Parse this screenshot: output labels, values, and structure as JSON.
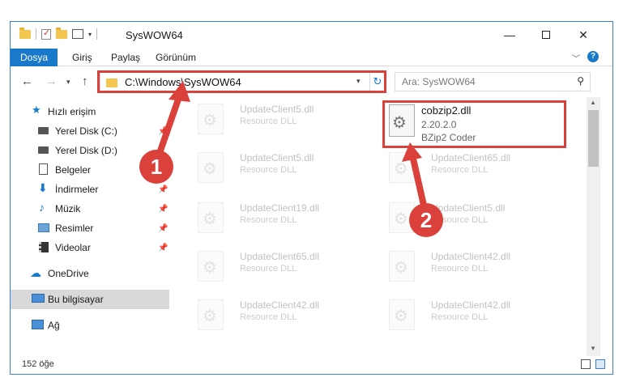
{
  "window": {
    "title": "SysWOW64",
    "controls": {
      "minimize": "—",
      "maximize": "",
      "close": "✕"
    }
  },
  "ribbon": {
    "tabs": [
      {
        "label": "Dosya",
        "active": true
      },
      {
        "label": "Giriş",
        "active": false
      },
      {
        "label": "Paylaş",
        "active": false
      },
      {
        "label": "Görünüm",
        "active": false
      }
    ],
    "help": "?"
  },
  "addressbar": {
    "path": "C:\\Windows\\SysWOW64",
    "search_placeholder": "Ara: SysWOW64"
  },
  "sidebar": {
    "items": [
      {
        "label": "Hızlı erişim",
        "icon": "star-icon",
        "pinned": false
      },
      {
        "label": "Yerel Disk (C:)",
        "icon": "drive-icon",
        "pinned": true
      },
      {
        "label": "Yerel Disk (D:)",
        "icon": "drive-icon",
        "pinned": false
      },
      {
        "label": "Belgeler",
        "icon": "document-icon",
        "pinned": true
      },
      {
        "label": "İndirmeler",
        "icon": "download-icon",
        "pinned": true
      },
      {
        "label": "Müzik",
        "icon": "music-icon",
        "pinned": true
      },
      {
        "label": "Resimler",
        "icon": "pictures-icon",
        "pinned": true
      },
      {
        "label": "Videolar",
        "icon": "video-icon",
        "pinned": true
      },
      {
        "label": "OneDrive",
        "icon": "cloud-icon",
        "pinned": false
      },
      {
        "label": "Bu bilgisayar",
        "icon": "computer-icon",
        "pinned": false,
        "selected": true
      },
      {
        "label": "Ağ",
        "icon": "network-icon",
        "pinned": false
      }
    ]
  },
  "files": {
    "left_column": [
      {
        "name": "UpdateClient5.dll",
        "desc": "Resource DLL"
      },
      {
        "name": "UpdateClient5.dll",
        "desc": "Resource DLL"
      },
      {
        "name": "UpdateClient19.dll",
        "desc": "Resource DLL"
      },
      {
        "name": "UpdateClient65.dll",
        "desc": "Resource DLL"
      },
      {
        "name": "UpdateClient42.dll",
        "desc": "Resource DLL"
      }
    ],
    "right_column": [
      {
        "name": "UpdateClient65.dll",
        "desc": "Resource DLL"
      },
      {
        "name": "UpdateClient5.dll",
        "desc": "Resource DLL"
      },
      {
        "name": "UpdateClient42.dll",
        "desc": "Resource DLL"
      },
      {
        "name": "UpdateClient42.dll",
        "desc": "Resource DLL"
      }
    ],
    "featured": {
      "name": "cobzip2.dll",
      "version": "2.20.2.0",
      "desc": "BZip2 Coder"
    }
  },
  "status": {
    "count": "152 öğe"
  },
  "annotations": {
    "step1": "1",
    "step2": "2",
    "color": "#d9413a"
  }
}
